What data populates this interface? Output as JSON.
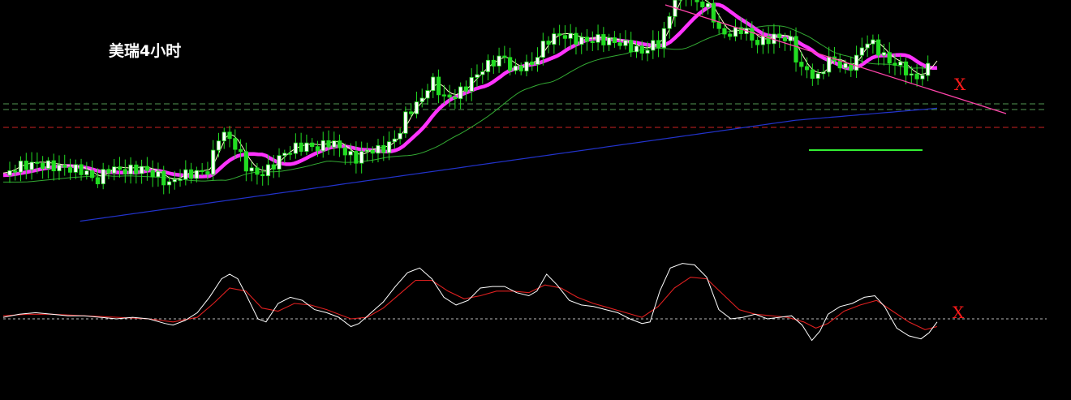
{
  "chart_data": [
    {
      "type": "candlestick",
      "title": "美瑞4小时",
      "markers": [
        "X"
      ],
      "colors": {
        "background": "#000000",
        "candle_up": "#ffffff",
        "candle_outline": "#22dd22",
        "ma_thick": "#ff33ff",
        "ma_fast": "#ffffcc",
        "ma_mid": "#33aa33",
        "ma_slow": "#2233cc",
        "trendline": "#ff44aa",
        "support_line": "#33ee33",
        "level_green": "#559955",
        "level_red": "#cc2222"
      },
      "y_domain": [
        0,
        100
      ],
      "price_path": [
        [
          0,
          30
        ],
        [
          20,
          34
        ],
        [
          40,
          35
        ],
        [
          60,
          34
        ],
        [
          80,
          33
        ],
        [
          100,
          32
        ],
        [
          115,
          27
        ],
        [
          130,
          33
        ],
        [
          150,
          32
        ],
        [
          170,
          33
        ],
        [
          190,
          30
        ],
        [
          205,
          26
        ],
        [
          220,
          30
        ],
        [
          240,
          31
        ],
        [
          255,
          32
        ],
        [
          265,
          47
        ],
        [
          275,
          48
        ],
        [
          285,
          44
        ],
        [
          300,
          34
        ],
        [
          315,
          30
        ],
        [
          330,
          33
        ],
        [
          345,
          39
        ],
        [
          360,
          42
        ],
        [
          375,
          43
        ],
        [
          390,
          42
        ],
        [
          405,
          45
        ],
        [
          420,
          41
        ],
        [
          435,
          37
        ],
        [
          450,
          41
        ],
        [
          465,
          41
        ],
        [
          480,
          44
        ],
        [
          490,
          49
        ],
        [
          500,
          58
        ],
        [
          515,
          62
        ],
        [
          530,
          72
        ],
        [
          545,
          64
        ],
        [
          560,
          65
        ],
        [
          575,
          70
        ],
        [
          590,
          76
        ],
        [
          605,
          80
        ],
        [
          620,
          82
        ],
        [
          630,
          75
        ],
        [
          640,
          78
        ],
        [
          655,
          79
        ],
        [
          665,
          86
        ],
        [
          675,
          90
        ],
        [
          690,
          92
        ],
        [
          705,
          90
        ],
        [
          720,
          89
        ],
        [
          735,
          90
        ],
        [
          750,
          89
        ],
        [
          765,
          88
        ],
        [
          780,
          86
        ],
        [
          790,
          84
        ],
        [
          800,
          87
        ],
        [
          810,
          88
        ],
        [
          820,
          95
        ],
        [
          830,
          108
        ],
        [
          845,
          111
        ],
        [
          860,
          106
        ],
        [
          875,
          103
        ],
        [
          885,
          93
        ],
        [
          900,
          92
        ],
        [
          915,
          95
        ],
        [
          930,
          88
        ],
        [
          945,
          90
        ],
        [
          960,
          91
        ],
        [
          975,
          89
        ],
        [
          985,
          76
        ],
        [
          995,
          77
        ],
        [
          1005,
          71
        ],
        [
          1015,
          78
        ],
        [
          1025,
          82
        ],
        [
          1035,
          78
        ],
        [
          1045,
          77
        ],
        [
          1055,
          81
        ],
        [
          1065,
          89
        ],
        [
          1075,
          88
        ],
        [
          1085,
          84
        ],
        [
          1095,
          80
        ],
        [
          1105,
          79
        ],
        [
          1115,
          77
        ],
        [
          1125,
          72
        ],
        [
          1135,
          74
        ],
        [
          1145,
          78
        ],
        [
          1155,
          83
        ]
      ],
      "oscillator": {
        "zero_level": 0,
        "fast": [
          [
            0,
            1
          ],
          [
            20,
            3
          ],
          [
            40,
            4
          ],
          [
            60,
            3
          ],
          [
            80,
            2
          ],
          [
            100,
            2
          ],
          [
            120,
            1
          ],
          [
            140,
            0
          ],
          [
            160,
            1
          ],
          [
            180,
            0
          ],
          [
            200,
            -3
          ],
          [
            210,
            -4
          ],
          [
            225,
            -1
          ],
          [
            240,
            4
          ],
          [
            255,
            14
          ],
          [
            270,
            26
          ],
          [
            280,
            29
          ],
          [
            290,
            26
          ],
          [
            300,
            16
          ],
          [
            315,
            0
          ],
          [
            325,
            -2
          ],
          [
            340,
            10
          ],
          [
            355,
            14
          ],
          [
            370,
            12
          ],
          [
            385,
            6
          ],
          [
            400,
            4
          ],
          [
            415,
            1
          ],
          [
            430,
            -5
          ],
          [
            440,
            -3
          ],
          [
            455,
            4
          ],
          [
            470,
            11
          ],
          [
            485,
            21
          ],
          [
            500,
            30
          ],
          [
            515,
            33
          ],
          [
            530,
            26
          ],
          [
            545,
            14
          ],
          [
            560,
            9
          ],
          [
            575,
            12
          ],
          [
            590,
            20
          ],
          [
            605,
            21
          ],
          [
            620,
            21
          ],
          [
            635,
            17
          ],
          [
            650,
            15
          ],
          [
            660,
            18
          ],
          [
            672,
            29
          ],
          [
            685,
            22
          ],
          [
            700,
            12
          ],
          [
            715,
            9
          ],
          [
            730,
            8
          ],
          [
            745,
            6
          ],
          [
            760,
            4
          ],
          [
            775,
            0
          ],
          [
            790,
            -3
          ],
          [
            800,
            -2
          ],
          [
            812,
            18
          ],
          [
            825,
            33
          ],
          [
            840,
            36
          ],
          [
            855,
            35
          ],
          [
            870,
            27
          ],
          [
            885,
            6
          ],
          [
            900,
            0
          ],
          [
            915,
            1
          ],
          [
            930,
            3
          ],
          [
            945,
            0
          ],
          [
            960,
            1
          ],
          [
            975,
            2
          ],
          [
            988,
            -4
          ],
          [
            1000,
            -14
          ],
          [
            1010,
            -8
          ],
          [
            1020,
            3
          ],
          [
            1035,
            8
          ],
          [
            1050,
            10
          ],
          [
            1065,
            14
          ],
          [
            1078,
            15
          ],
          [
            1090,
            8
          ],
          [
            1105,
            -6
          ],
          [
            1120,
            -11
          ],
          [
            1135,
            -13
          ],
          [
            1145,
            -9
          ],
          [
            1155,
            -2
          ]
        ],
        "slow": [
          [
            0,
            2
          ],
          [
            30,
            3
          ],
          [
            60,
            3
          ],
          [
            100,
            2
          ],
          [
            140,
            1
          ],
          [
            180,
            0
          ],
          [
            210,
            -2
          ],
          [
            240,
            1
          ],
          [
            260,
            10
          ],
          [
            280,
            20
          ],
          [
            300,
            18
          ],
          [
            320,
            7
          ],
          [
            340,
            5
          ],
          [
            360,
            10
          ],
          [
            380,
            9
          ],
          [
            400,
            6
          ],
          [
            430,
            0
          ],
          [
            450,
            1
          ],
          [
            470,
            7
          ],
          [
            490,
            16
          ],
          [
            510,
            25
          ],
          [
            530,
            25
          ],
          [
            550,
            18
          ],
          [
            570,
            13
          ],
          [
            590,
            15
          ],
          [
            610,
            18
          ],
          [
            630,
            18
          ],
          [
            650,
            17
          ],
          [
            670,
            22
          ],
          [
            690,
            20
          ],
          [
            710,
            14
          ],
          [
            730,
            10
          ],
          [
            750,
            7
          ],
          [
            770,
            4
          ],
          [
            790,
            1
          ],
          [
            810,
            8
          ],
          [
            830,
            20
          ],
          [
            850,
            27
          ],
          [
            870,
            26
          ],
          [
            890,
            16
          ],
          [
            910,
            6
          ],
          [
            930,
            3
          ],
          [
            950,
            2
          ],
          [
            970,
            1
          ],
          [
            990,
            -2
          ],
          [
            1005,
            -6
          ],
          [
            1020,
            -3
          ],
          [
            1040,
            5
          ],
          [
            1060,
            9
          ],
          [
            1080,
            12
          ],
          [
            1100,
            5
          ],
          [
            1120,
            -2
          ],
          [
            1140,
            -7
          ],
          [
            1155,
            -5
          ]
        ]
      }
    }
  ]
}
